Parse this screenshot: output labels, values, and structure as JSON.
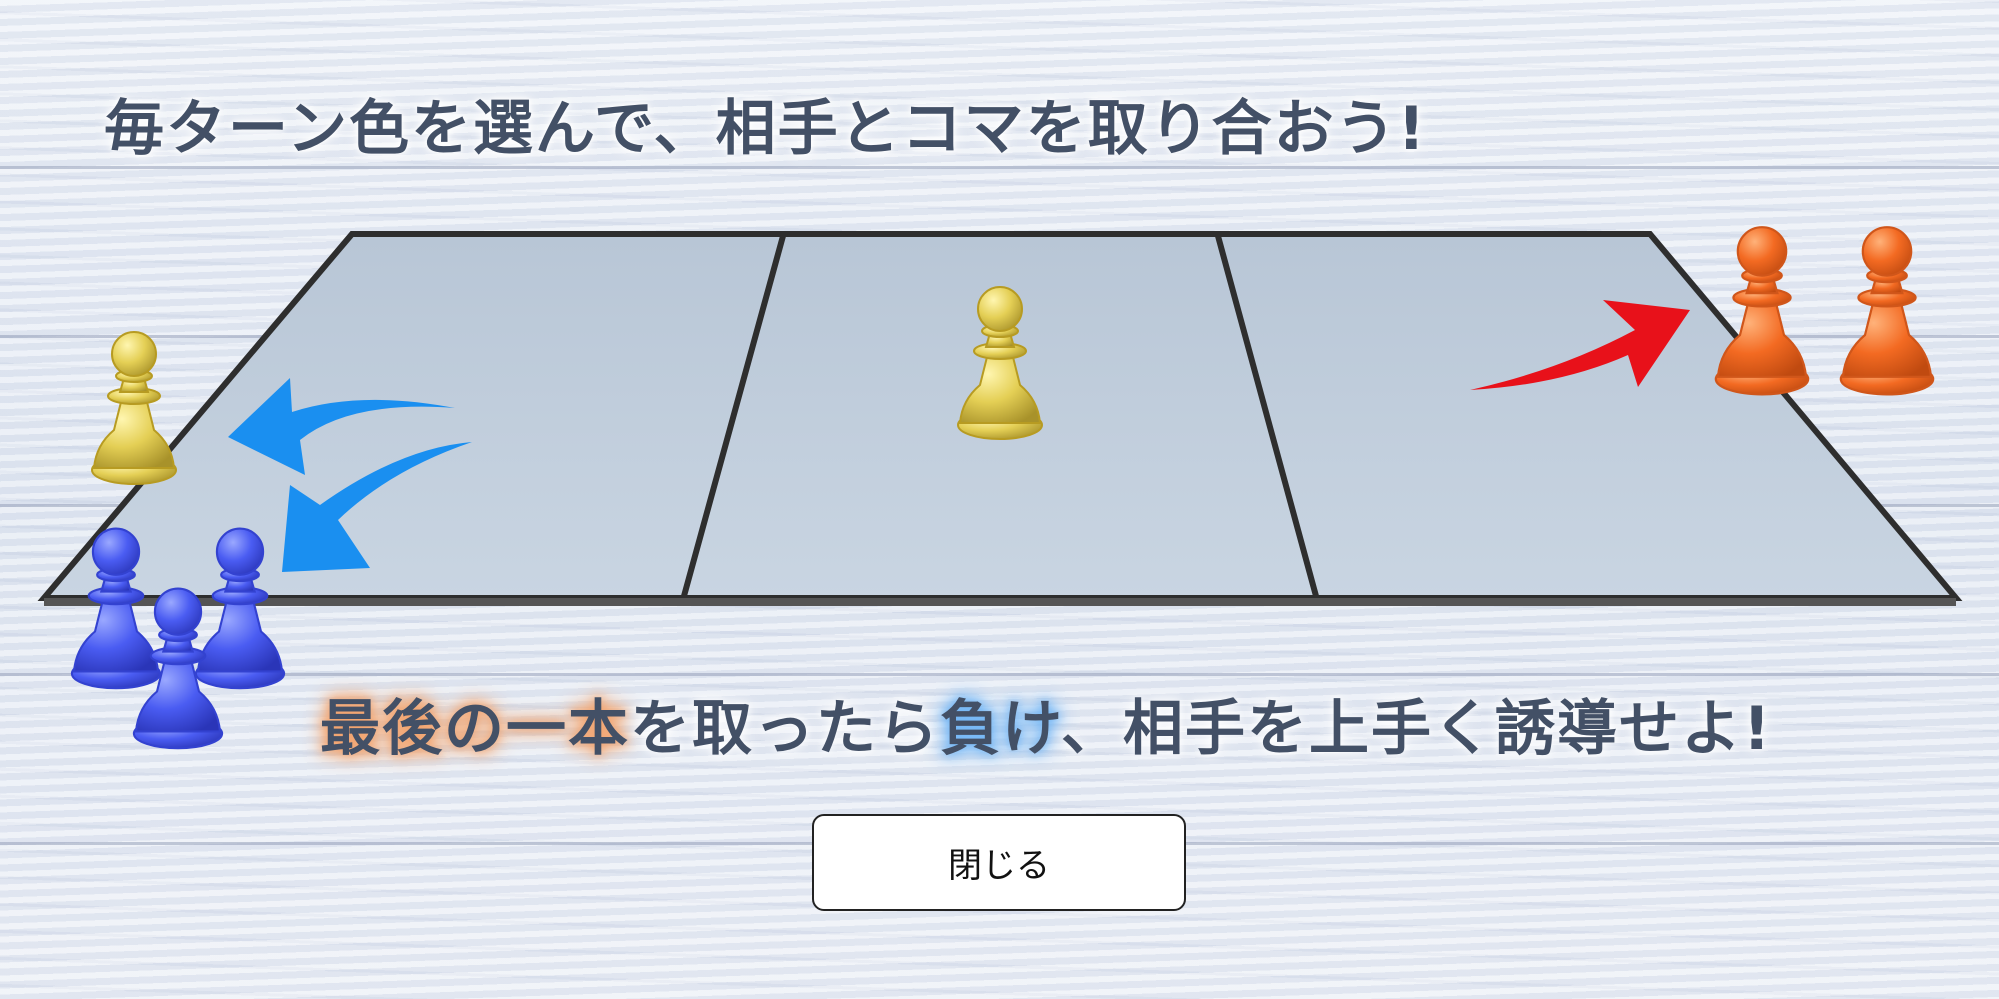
{
  "instructions": {
    "headline": "毎ターン色を選んで、相手とコマを取り合おう!",
    "subline": {
      "part1": "最後の一本",
      "part2": "を取ったら",
      "part3": "負け",
      "part4": "、相手を上手く誘導せよ!"
    }
  },
  "buttons": {
    "close_label": "閉じる"
  },
  "pieces": {
    "board_center": "yellow",
    "left_side": [
      "yellow",
      "blue",
      "blue",
      "blue"
    ],
    "right_side": [
      "orange",
      "orange"
    ]
  },
  "colors": {
    "text": "#435066",
    "blue_piece": "#4a5cf2",
    "yellow_piece": "#e6d35a",
    "orange_piece": "#f36a22",
    "arrow_blue": "#1a8ff0",
    "arrow_red": "#e8111a",
    "highlight_orange": "#f3a36d",
    "highlight_blue": "#6fb4f5"
  }
}
